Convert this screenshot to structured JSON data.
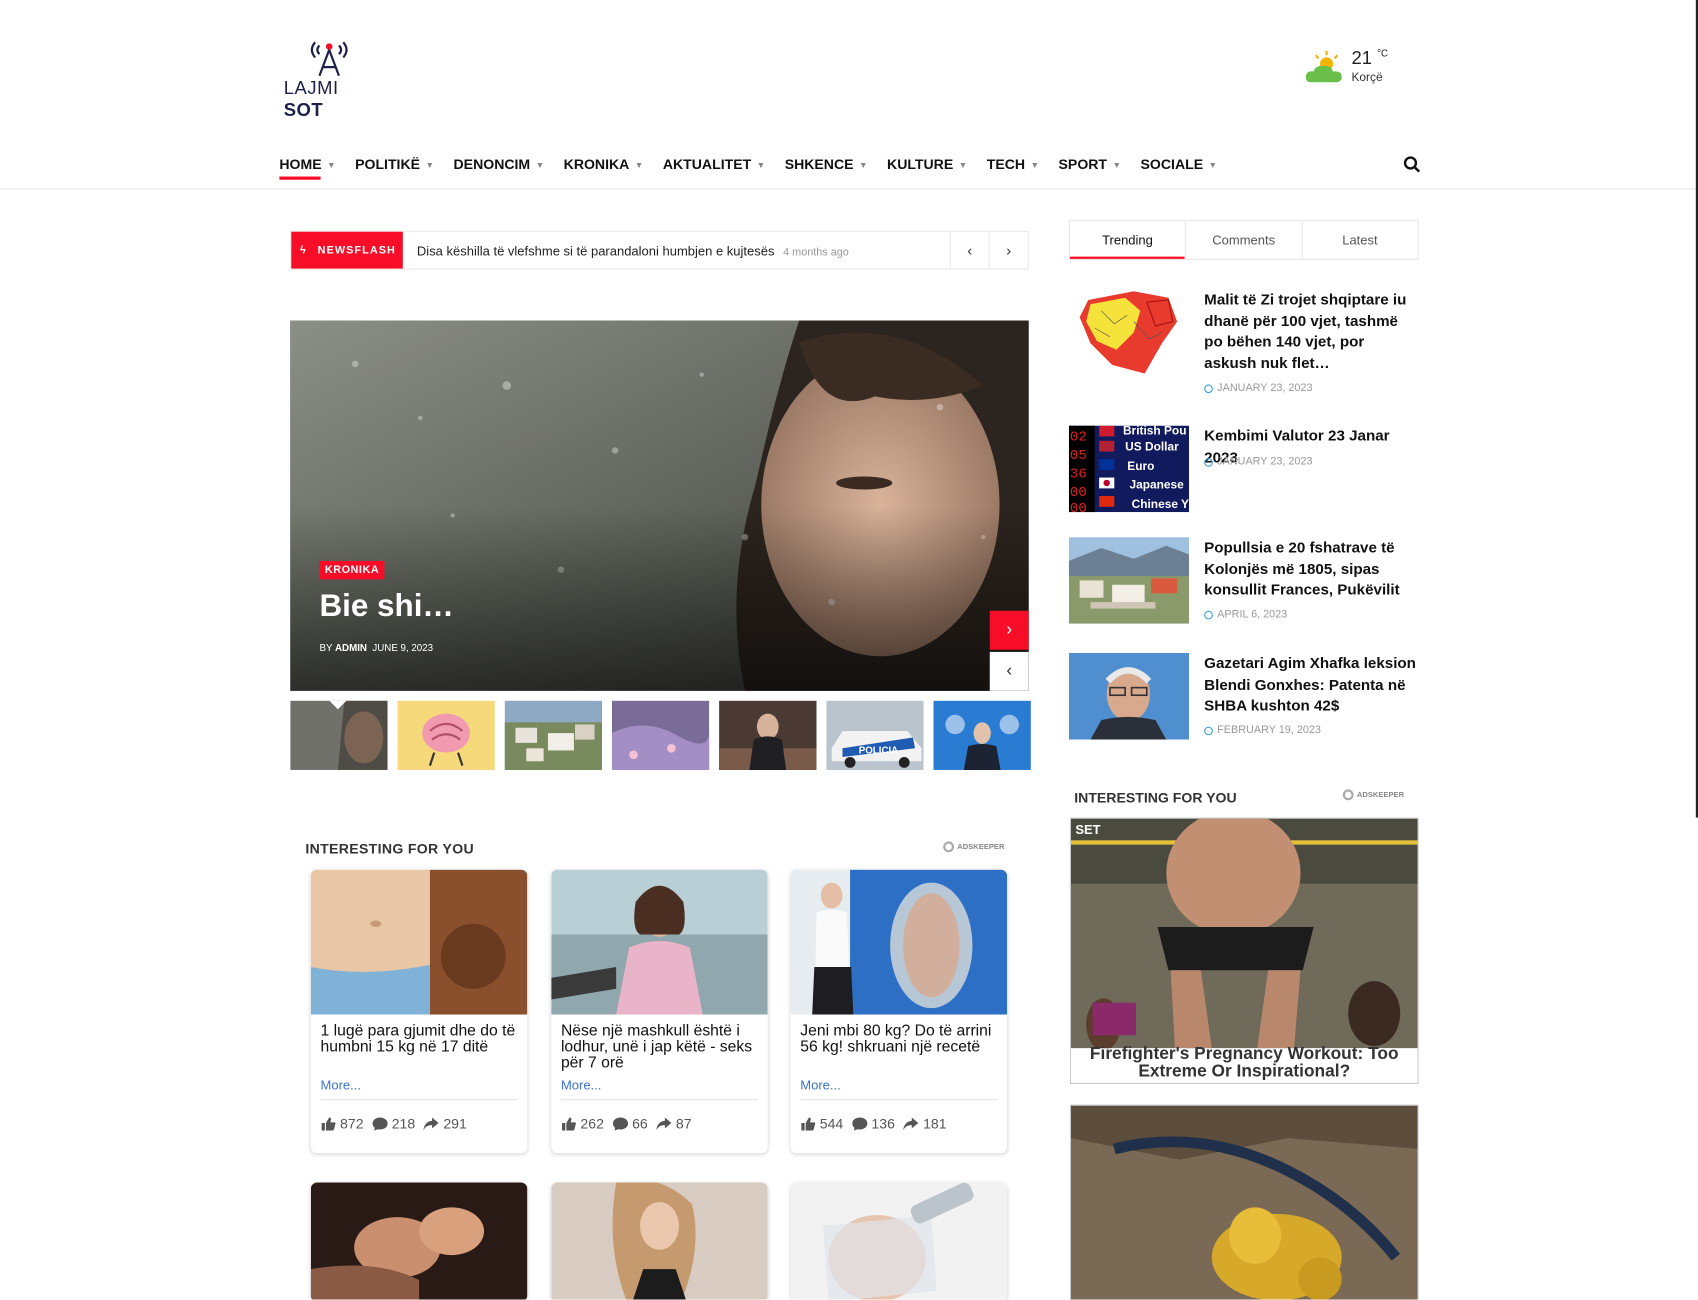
{
  "brand": {
    "logo_word1": "LAJMI",
    "logo_word2": "SOT"
  },
  "weather": {
    "temp": "21",
    "unit": "°C",
    "city": "Korçë",
    "icon": "cloud-sun-icon"
  },
  "nav": {
    "items": [
      "HOME",
      "POLITIKË",
      "DENONCIM",
      "KRONIKA",
      "AKTUALITET",
      "SHKENCE",
      "KULTURE",
      "TECH",
      "SPORT",
      "SOCIALE"
    ],
    "active": "HOME",
    "accent": "#f70d28"
  },
  "newsflash": {
    "label": "NEWSFLASH",
    "headline": "Disa këshilla të vlefshme si të parandaloni humbjen e kujtesës",
    "time": "4 months ago"
  },
  "hero": {
    "category": "KRONIKA",
    "title": "Bie shi…",
    "by": "BY",
    "author": "ADMIN",
    "date": "JUNE 9, 2023"
  },
  "interesting_left": {
    "heading": "INTERESTING FOR YOU",
    "adkeeper": "ADSKEEPER",
    "cards": [
      {
        "title": "1 lugë para gjumit dhe do të humbni 15 kg në 17 ditë",
        "more": "More...",
        "likes": "872",
        "comments": "218",
        "shares": "291"
      },
      {
        "title": "Nëse një mashkull është i lodhur, unë i jap këtë - seks për 7 orë",
        "more": "More...",
        "likes": "262",
        "comments": "66",
        "shares": "87"
      },
      {
        "title": "Jeni mbi 80 kg? Do të arrini 56 kg! shkruani një recetë",
        "more": "More...",
        "likes": "544",
        "comments": "136",
        "shares": "181"
      }
    ]
  },
  "sidebar": {
    "tabs": [
      "Trending",
      "Comments",
      "Latest"
    ],
    "active_tab": "Trending",
    "trending": [
      {
        "title": "Malit të Zi trojet shqiptare iu dhanë për 100 vjet, tashmë po bëhen 140 vjet, por askush nuk flet…",
        "date": "JANUARY 23, 2023"
      },
      {
        "title": "Kembimi Valutor 23 Janar 2023",
        "date": "JANUARY 23, 2023"
      },
      {
        "title": "Popullsia e 20 fshatrave të Kolonjës më 1805, sipas konsullit Frances, Pukëvilit",
        "date": "APRIL 6, 2023"
      },
      {
        "title": "Gazetari Agim Xhafka leksion Blendi Gonxhes: Patenta në SHBA kushton 42$",
        "date": "FEBRUARY 19, 2023"
      }
    ],
    "currency_labels": [
      "British Pou",
      "US Dollar",
      "Euro",
      "Japanese",
      "Chinese Y"
    ],
    "interesting_heading": "INTERESTING FOR YOU",
    "adkeeper": "ADSKEEPER",
    "ad1_caption": "Firefighter's Pregnancy Workout: Too Extreme Or Inspirational?",
    "ad1_banner": "SET"
  },
  "thumb_badge": "POLICIA"
}
